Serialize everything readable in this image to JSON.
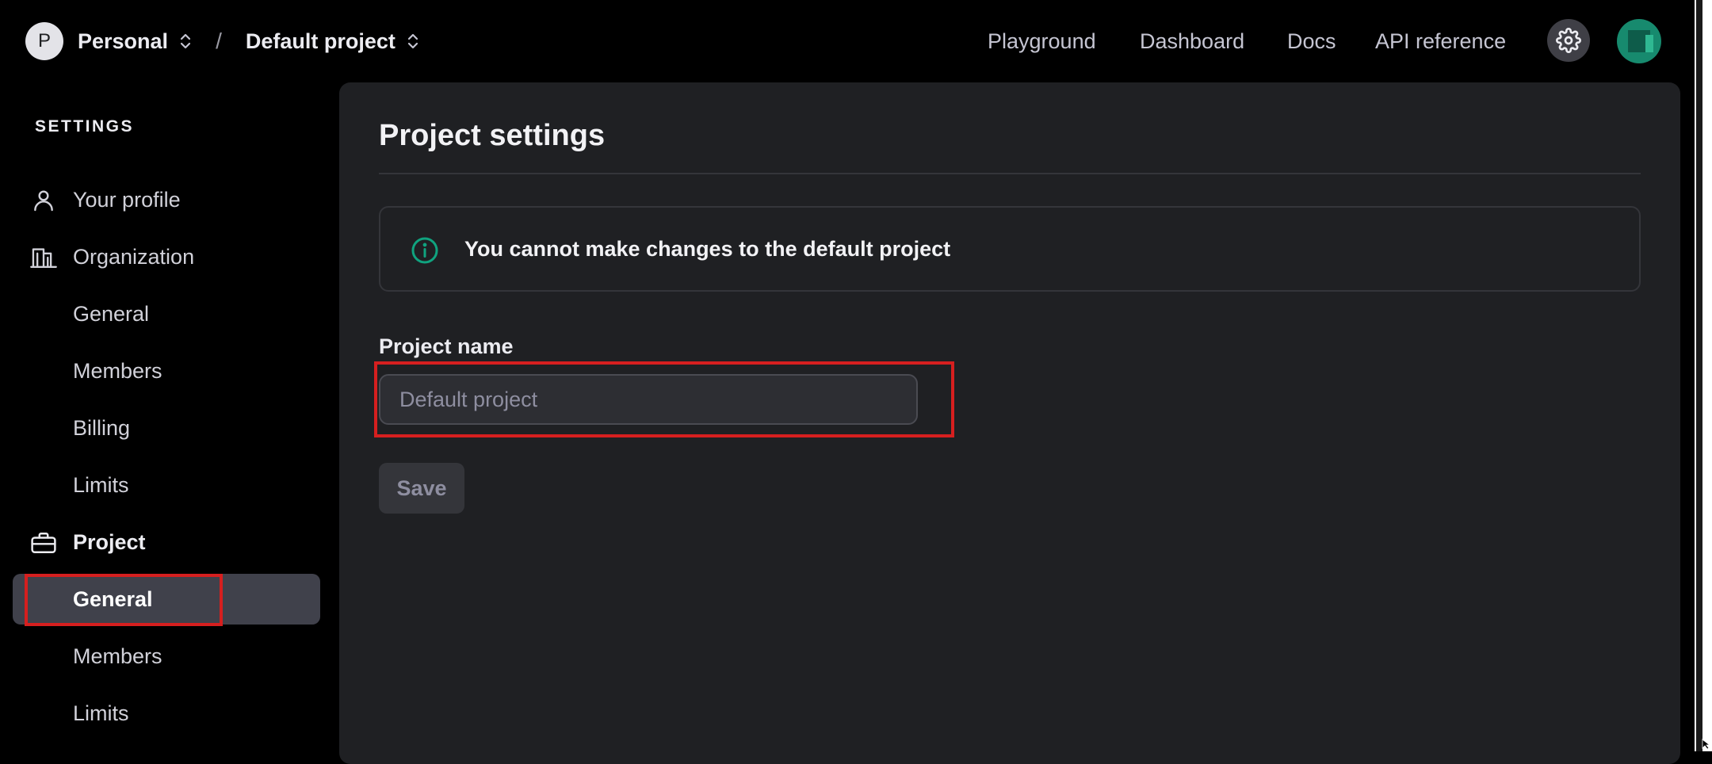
{
  "header": {
    "org_initial": "P",
    "org_name": "Personal",
    "separator": "/",
    "project_name": "Default project",
    "nav": [
      {
        "label": "Playground"
      },
      {
        "label": "Dashboard"
      },
      {
        "label": "Docs"
      },
      {
        "label": "API reference"
      }
    ],
    "settings_icon": "gear-icon",
    "user_avatar_color": "#178a6e"
  },
  "sidebar": {
    "heading": "SETTINGS",
    "items": [
      {
        "label": "Your profile",
        "icon": "person-icon"
      },
      {
        "label": "Organization",
        "icon": "building-icon"
      },
      {
        "label": "General"
      },
      {
        "label": "Members"
      },
      {
        "label": "Billing"
      },
      {
        "label": "Limits"
      },
      {
        "label": "Project",
        "icon": "briefcase-icon"
      },
      {
        "label": "General",
        "active": true
      },
      {
        "label": "Members"
      },
      {
        "label": "Limits"
      }
    ]
  },
  "main": {
    "title": "Project settings",
    "notice": "You cannot make changes to the default project",
    "notice_icon": "info-icon",
    "field_label": "Project name",
    "field_placeholder": "Default project",
    "field_value": "",
    "save_label": "Save"
  },
  "colors": {
    "accent_info": "#10a37f",
    "highlight": "#d61f1f",
    "panel_bg": "#1f2023",
    "active_item_bg": "#40414b"
  }
}
